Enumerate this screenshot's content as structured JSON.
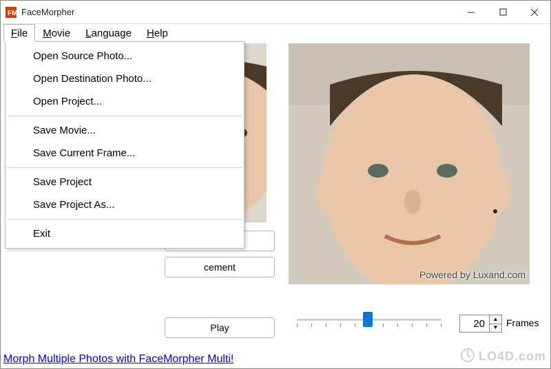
{
  "title": "FaceMorpher",
  "menubar": {
    "file": {
      "label": "File",
      "accel": "F"
    },
    "movie": {
      "label": "Movie",
      "accel": "M"
    },
    "language": {
      "label": "Language",
      "accel": "L"
    },
    "help": {
      "label": "Help",
      "accel": "H"
    }
  },
  "file_menu": {
    "open_source": "Open Source Photo...",
    "open_dest": "Open Destination Photo...",
    "open_project": "Open Project...",
    "save_movie": "Save Movie...",
    "save_frame": "Save Current Frame...",
    "save_project": "Save Project",
    "save_project_as": "Save Project As...",
    "exit": "Exit"
  },
  "buttons": {
    "open_dest_partial": "...",
    "adjust_partial": "cement",
    "play": "Play"
  },
  "preview": {
    "watermark": "Powered by Luxand.com"
  },
  "slider": {
    "value": 0.5,
    "ticks": 10
  },
  "frames": {
    "value": "20",
    "label": "Frames"
  },
  "bottom_link": "Morph Multiple Photos with FaceMorpher Multi!",
  "site_watermark": "LO4D.com"
}
